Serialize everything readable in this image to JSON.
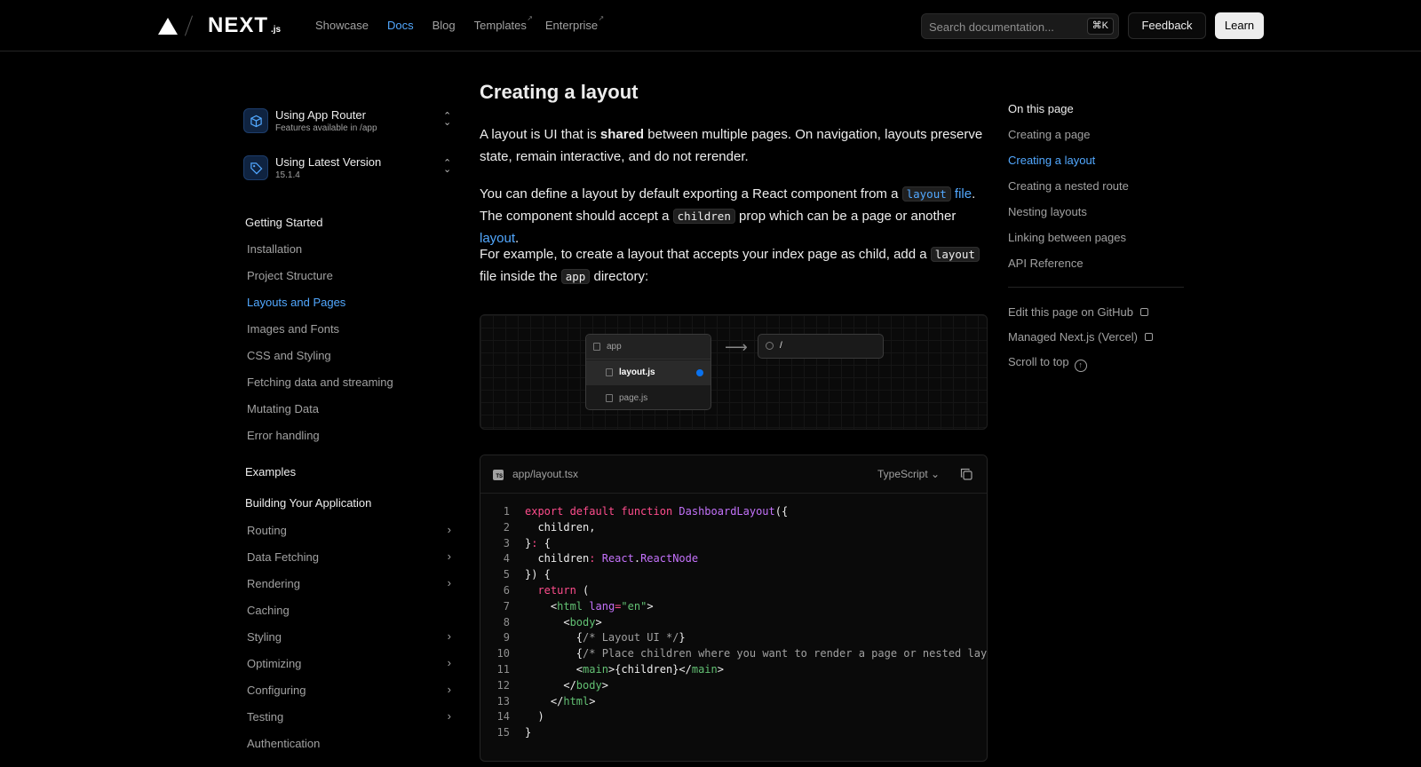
{
  "header": {
    "logo_text": "NEXT",
    "logo_suffix": ".js",
    "nav": [
      {
        "label": "Showcase"
      },
      {
        "label": "Docs"
      },
      {
        "label": "Blog"
      },
      {
        "label": "Templates",
        "external": true
      },
      {
        "label": "Enterprise",
        "external": true
      }
    ],
    "search_placeholder": "Search documentation...",
    "search_shortcut": "⌘K",
    "feedback_label": "Feedback",
    "learn_label": "Learn"
  },
  "sidebar": {
    "switchers": [
      {
        "title": "Using App Router",
        "subtitle": "Features available in /app",
        "icon": "cube-icon"
      },
      {
        "title": "Using Latest Version",
        "subtitle": "15.1.4",
        "icon": "tag-icon"
      }
    ],
    "getting_started_heading": "Getting Started",
    "getting_started": [
      "Installation",
      "Project Structure",
      "Layouts and Pages",
      "Images and Fonts",
      "CSS and Styling",
      "Fetching data and streaming",
      "Mutating Data",
      "Error handling"
    ],
    "active_item": "Layouts and Pages",
    "examples_heading": "Examples",
    "building_heading": "Building Your Application",
    "building": [
      {
        "label": "Routing",
        "expandable": true
      },
      {
        "label": "Data Fetching",
        "expandable": true
      },
      {
        "label": "Rendering",
        "expandable": true
      },
      {
        "label": "Caching",
        "expandable": false
      },
      {
        "label": "Styling",
        "expandable": true
      },
      {
        "label": "Optimizing",
        "expandable": true
      },
      {
        "label": "Configuring",
        "expandable": true
      },
      {
        "label": "Testing",
        "expandable": true
      },
      {
        "label": "Authentication",
        "expandable": false
      }
    ]
  },
  "main": {
    "title": "Creating a layout",
    "p1": {
      "a": "A layout is UI that is ",
      "b": "shared",
      "c": " between multiple pages. On navigation, layouts preserve state, remain interactive, and do not rerender."
    },
    "p2": {
      "a": "You can define a layout by default exporting a React component from a ",
      "code1": "layout",
      "link1": "file",
      "b": ". The component should accept a ",
      "code2": "children",
      "c": " prop which can be a page or another ",
      "link2": "layout",
      "d": "."
    },
    "p3": {
      "a": "For example, to create a layout that accepts your index page as child, add a ",
      "code1": "layout",
      "b": " file inside the ",
      "code2": "app",
      "c": " directory:"
    },
    "diagram": {
      "folder": "app",
      "file_selected": "layout.js",
      "file_other": "page.js",
      "route": "/"
    },
    "code": {
      "filename": "app/layout.tsx",
      "language": "TypeScript",
      "line_numbers": [
        "1",
        "2",
        "3",
        "4",
        "5",
        "6",
        "7",
        "8",
        "9",
        "10",
        "11",
        "12",
        "13",
        "14",
        "15"
      ]
    }
  },
  "toc": {
    "title": "On this page",
    "items": [
      "Creating a page",
      "Creating a layout",
      "Creating a nested route",
      "Nesting layouts",
      "Linking between pages",
      "API Reference"
    ],
    "active": "Creating a layout",
    "links": {
      "edit": "Edit this page on GitHub",
      "managed": "Managed Next.js (Vercel)",
      "top": "Scroll to top"
    }
  },
  "colors": {
    "accent": "#52a8ff",
    "background": "#000000",
    "keyword": "#ff4d8d",
    "function": "#c472fb",
    "tag": "#62c073"
  }
}
